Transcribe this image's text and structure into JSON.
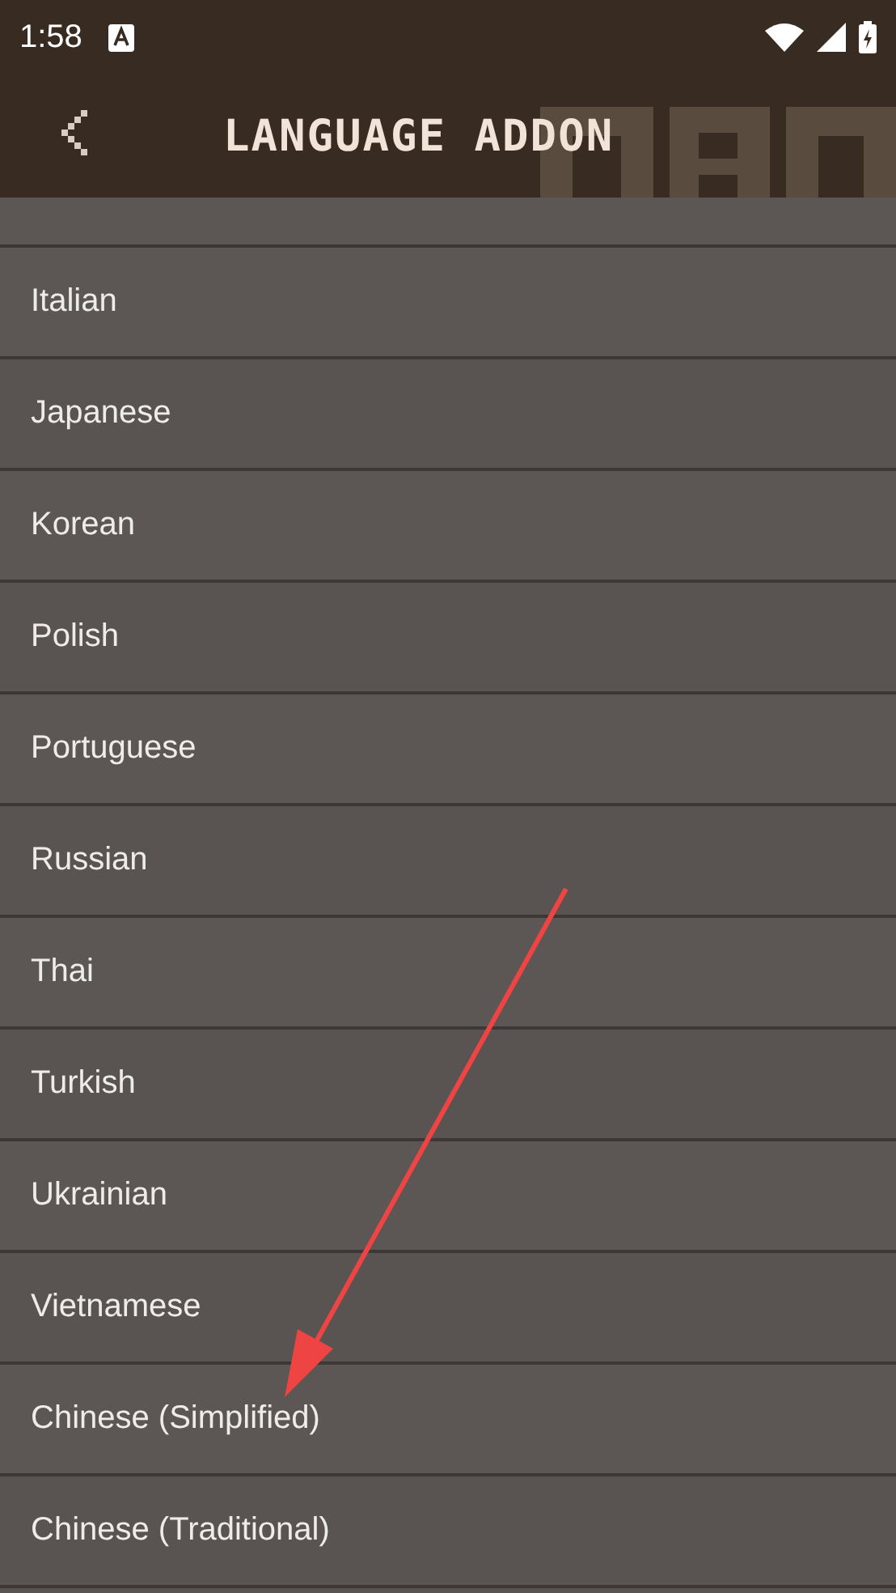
{
  "status_bar": {
    "time": "1:58"
  },
  "header": {
    "title": "LANGUAGE ADDON"
  },
  "languages": [
    {
      "label": "Italian"
    },
    {
      "label": "Japanese"
    },
    {
      "label": "Korean"
    },
    {
      "label": "Polish"
    },
    {
      "label": "Portuguese"
    },
    {
      "label": "Russian"
    },
    {
      "label": "Thai"
    },
    {
      "label": "Turkish"
    },
    {
      "label": "Ukrainian"
    },
    {
      "label": "Vietnamese"
    },
    {
      "label": "Chinese (Simplified)"
    },
    {
      "label": "Chinese (Traditional)"
    }
  ],
  "annotation": {
    "kind": "arrow"
  }
}
